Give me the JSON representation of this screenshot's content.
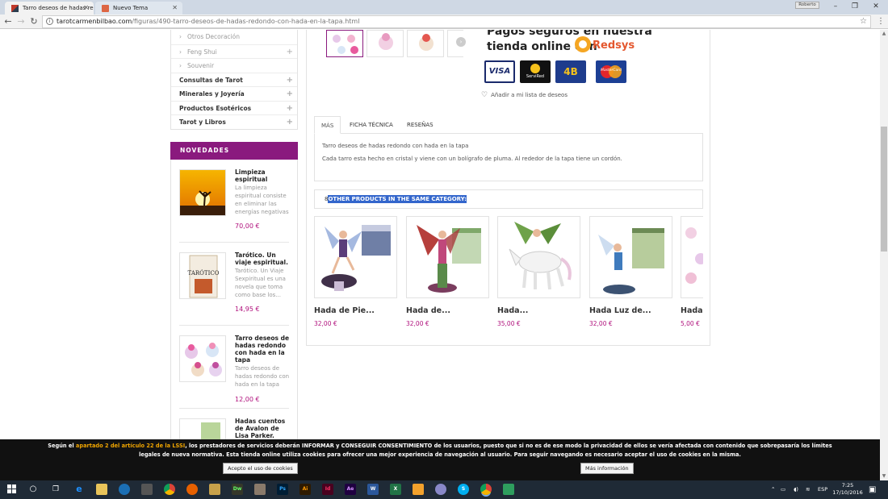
{
  "browser": {
    "tabs": [
      {
        "title": "Tarro deseos de hadas re",
        "active": true
      },
      {
        "title": "Nuevo Tema",
        "active": false
      }
    ],
    "user_chip": "Roberto",
    "url_host": "tarotcarmenbilbao.com",
    "url_path": "/figuras/490-tarro-deseos-de-hadas-redondo-con-hada-en-la-tapa.html"
  },
  "sidebar": {
    "categories": [
      {
        "label": "Otros Decoración",
        "type": "sub",
        "plus": false
      },
      {
        "label": "Feng Shui",
        "type": "sub",
        "plus": true
      },
      {
        "label": "Souvenir",
        "type": "sub",
        "plus": false
      },
      {
        "label": "Consultas de Tarot",
        "type": "main",
        "plus": true
      },
      {
        "label": "Minerales y Joyería",
        "type": "main",
        "plus": true
      },
      {
        "label": "Productos Esotéricos",
        "type": "main",
        "plus": true
      },
      {
        "label": "Tarot y Libros",
        "type": "main",
        "plus": true
      }
    ],
    "novedades_title": "NOVEDADES",
    "novedades": [
      {
        "name": "Limpieza espiritual",
        "desc": "La limpieza espiritual consiste en eliminar las energías negativas",
        "price": "70,00 €"
      },
      {
        "name": "Tarótico. Un viaje espiritual.",
        "desc": "Tarótico. Un Viaje Sexpiritual es una novela que toma como base los...",
        "price": "14,95 €"
      },
      {
        "name": "Tarro deseos de hadas redondo con hada en la tapa",
        "desc": "Tarro deseos de hadas redondo con hada en la tapa",
        "price": "12,00 €"
      },
      {
        "name": "Hadas cuentos de Avalon de Lisa Parker. Hada",
        "desc": "",
        "price": ""
      }
    ]
  },
  "product": {
    "pay_text_line1": "Pagos seguros en nuestra",
    "pay_text_line2": "tienda online con",
    "redsys_label": "Redsys",
    "cards": [
      "VISA",
      "ServiRed",
      "4B",
      "MasterCard"
    ],
    "wishlist_label": "Añadir a mi lista de deseos",
    "tabs": [
      "MÁS",
      "FICHA TÉCNICA",
      "RESEÑAS"
    ],
    "description_1": "Tarro deseos de hadas redondo con hada en la tapa",
    "description_2": "Cada tarro esta hecho en cristal y viene con un bolígrafo de pluma. Al rededor de la tapa tiene un cordón.",
    "other_count": "8",
    "other_title": "OTHER PRODUCTS IN THE SAME CATEGORY:",
    "other_products": [
      {
        "name": "Hada de Pie...",
        "price": "32,00 €"
      },
      {
        "name": "Hada de...",
        "price": "32,00 €"
      },
      {
        "name": "Hada...",
        "price": "35,00 €"
      },
      {
        "name": "Hada Luz de...",
        "price": "32,00 €"
      },
      {
        "name": "Hada L",
        "price": "5,00 €"
      }
    ]
  },
  "cookie": {
    "text_before": "Según el",
    "link": "apartado 2 del artículo 22 de la LSSI",
    "text_after": ", los prestadores de servicios deberán INFORMAR y CONSEGUIR CONSENTIMIENTO de los usuarios, puesto que si no es de ese modo la privacidad de ellos se vería afectada con contenido que sobrepasaría los límites",
    "line2": "legales de nueva normativa. Esta tienda online utiliza cookies para ofrecer una mejor experiencia de navegación al usuario. Para seguir navegando es necesario aceptar el uso de cookies en la misma.",
    "accept_label": "Acepto el uso de cookies",
    "more_label": "Más información"
  },
  "taskbar": {
    "language": "ESP",
    "time": "7:25",
    "date": "17/10/2016"
  },
  "colors": {
    "brand": "#8a1a7e",
    "price": "#b0107c",
    "highlight": "#3366cc"
  }
}
